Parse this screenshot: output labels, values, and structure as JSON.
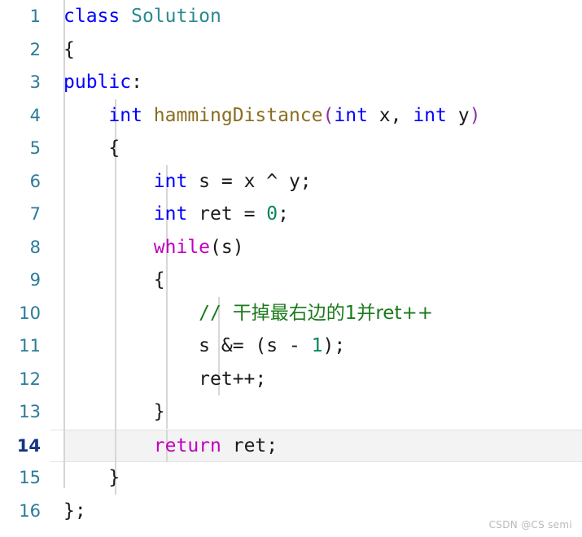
{
  "editor": {
    "language": "cpp",
    "background_color": "#ffffff",
    "line_height_px": 40.5,
    "font_size_px": 23,
    "active_line": 14,
    "gutter": {
      "number_color": "#2b7a9b",
      "active_number_color": "#14377d",
      "border_color": "#d5d5d5"
    },
    "theme_colors": {
      "keyword": "#0000ff",
      "control_keyword": "#c000c0",
      "type_name": "#2b8a8f",
      "function_name": "#8a6d1f",
      "number_literal": "#098658",
      "comment": "#1a7a1a",
      "paren_level_1": "#8a2fa8",
      "plain_text": "#1a1a1a",
      "current_line_background": "#f3f3f3",
      "indent_guide": "#d7d7d7"
    }
  },
  "line_numbers": [
    "1",
    "2",
    "3",
    "4",
    "5",
    "6",
    "7",
    "8",
    "9",
    "10",
    "11",
    "12",
    "13",
    "14",
    "15",
    "16"
  ],
  "code": {
    "line1": {
      "kw_class": "class",
      "type_name": " Solution"
    },
    "line2": {
      "brace": "{"
    },
    "line3": {
      "kw_public": "public",
      "colon": ":"
    },
    "line4": {
      "indent": "    ",
      "kw_int": "int",
      "space": " ",
      "func_name": "hammingDistance",
      "paren_open": "(",
      "kw_int2": "int",
      "param_x": " x, ",
      "kw_int3": "int",
      "param_y": " y",
      "paren_close": ")"
    },
    "line5": {
      "indent": "    ",
      "brace": "{"
    },
    "line6": {
      "indent": "        ",
      "kw_int": "int",
      "expr": " s = x ^ y;"
    },
    "line7": {
      "indent": "        ",
      "kw_int": "int",
      "mid": " ret = ",
      "number": "0",
      "end": ";"
    },
    "line8": {
      "indent": "        ",
      "kw_while": "while",
      "cond": "(s)"
    },
    "line9": {
      "indent": "        ",
      "brace": "{"
    },
    "line10": {
      "indent": "            ",
      "slashes": "// ",
      "comment_text": "干掉最右边的1并ret++"
    },
    "line11": {
      "indent": "            ",
      "pre": "s &= (s - ",
      "number": "1",
      "post": ");"
    },
    "line12": {
      "indent": "            ",
      "expr": "ret++;"
    },
    "line13": {
      "indent": "        ",
      "brace": "}"
    },
    "line14": {
      "indent": "        ",
      "kw_return": "return",
      "expr": " ret;"
    },
    "line15": {
      "indent": "    ",
      "brace": "}"
    },
    "line16": {
      "brace": "};"
    }
  },
  "watermark": {
    "text": "CSDN @CS semi"
  }
}
